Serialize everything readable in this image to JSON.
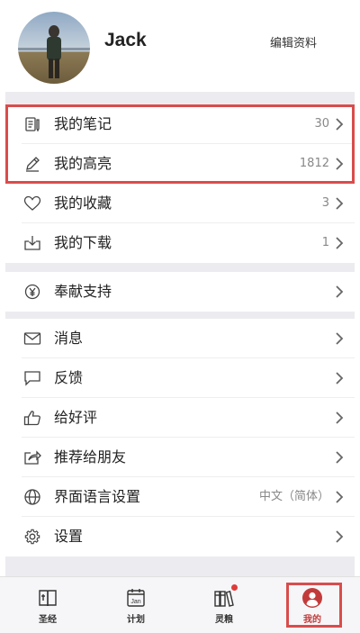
{
  "profile": {
    "name": "Jack",
    "edit_label": "编辑资料"
  },
  "group1": [
    {
      "label": "我的笔记",
      "value": "30",
      "icon": "notes-icon"
    },
    {
      "label": "我的高亮",
      "value": "1812",
      "icon": "pencil-icon"
    },
    {
      "label": "我的收藏",
      "value": "3",
      "icon": "heart-icon"
    },
    {
      "label": "我的下载",
      "value": "1",
      "icon": "download-icon"
    }
  ],
  "group2": [
    {
      "label": "奉献支持",
      "value": "",
      "icon": "yen-coin-icon"
    }
  ],
  "group3": [
    {
      "label": "消息",
      "value": "",
      "icon": "mail-icon"
    },
    {
      "label": "反馈",
      "value": "",
      "icon": "chat-bubble-icon"
    },
    {
      "label": "给好评",
      "value": "",
      "icon": "thumbs-up-icon"
    },
    {
      "label": "推荐给朋友",
      "value": "",
      "icon": "share-icon"
    },
    {
      "label": "界面语言设置",
      "value": "中文（简体）",
      "icon": "globe-icon"
    },
    {
      "label": "设置",
      "value": "",
      "icon": "gear-icon"
    }
  ],
  "tabs": [
    {
      "label": "圣经",
      "icon": "bible-icon",
      "active": false
    },
    {
      "label": "计划",
      "icon": "calendar-icon",
      "calendar_text": "Jan",
      "active": false
    },
    {
      "label": "灵粮",
      "icon": "books-icon",
      "active": false
    },
    {
      "label": "我的",
      "icon": "user-icon",
      "active": true
    }
  ],
  "colors": {
    "accent": "#c23b3b",
    "highlight_border": "#d94c4c",
    "separator": "#ececf0"
  }
}
